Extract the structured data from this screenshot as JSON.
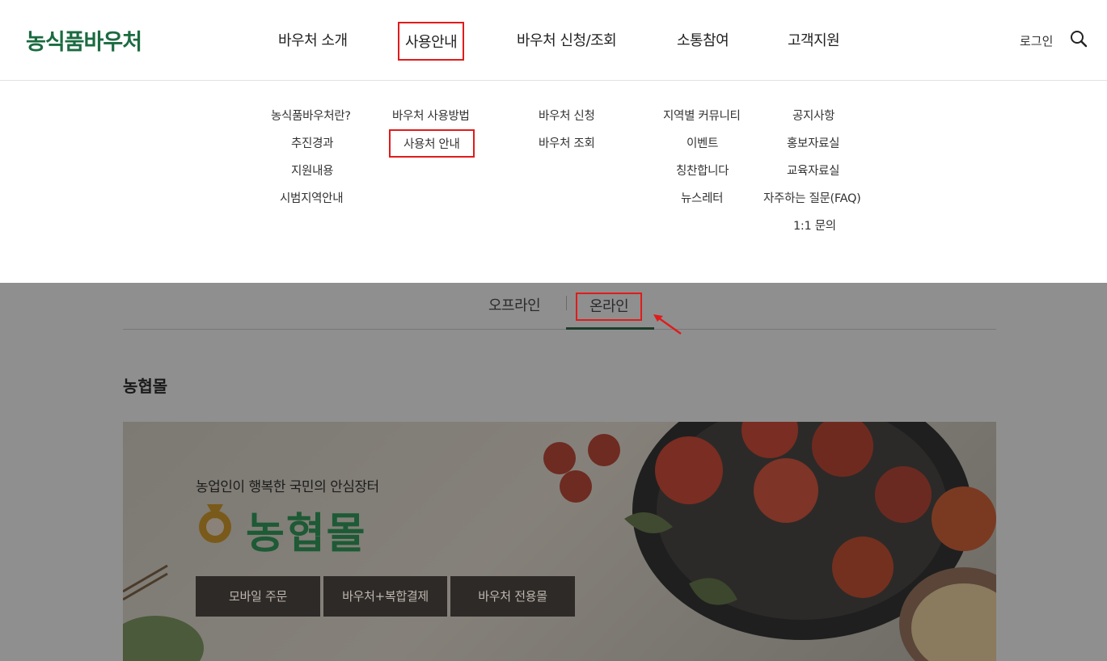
{
  "header": {
    "logo": "농식품바우처",
    "nav": [
      "바우처 소개",
      "사용안내",
      "바우처 신청/조회",
      "소통참여",
      "고객지원"
    ],
    "login_label": "로그인",
    "search_icon": "search-icon"
  },
  "submenu": {
    "col1": [
      "농식품바우처란?",
      "추진경과",
      "지원내용",
      "시범지역안내"
    ],
    "col2": [
      "바우처 사용방법",
      "사용처 안내"
    ],
    "col3": [
      "바우처 신청",
      "바우처 조회"
    ],
    "col4": [
      "지역별 커뮤니티",
      "이벤트",
      "칭찬합니다",
      "뉴스레터"
    ],
    "col5": [
      "공지사항",
      "홍보자료실",
      "교육자료실",
      "자주하는 질문(FAQ)",
      "1:1 문의"
    ]
  },
  "tabs": [
    "오프라인",
    "온라인"
  ],
  "section": {
    "title": "농협몰",
    "banner_slogan": "농업인이 행복한 국민의 안심장터",
    "banner_logo": "농협몰",
    "buttons": [
      "모바일 주문",
      "바우처+복합결제",
      "바우처 전용몰"
    ]
  },
  "colors": {
    "highlight": "#e11b1b",
    "brand_green": "#1b6b40",
    "tab_active": "#1e3c2b"
  }
}
